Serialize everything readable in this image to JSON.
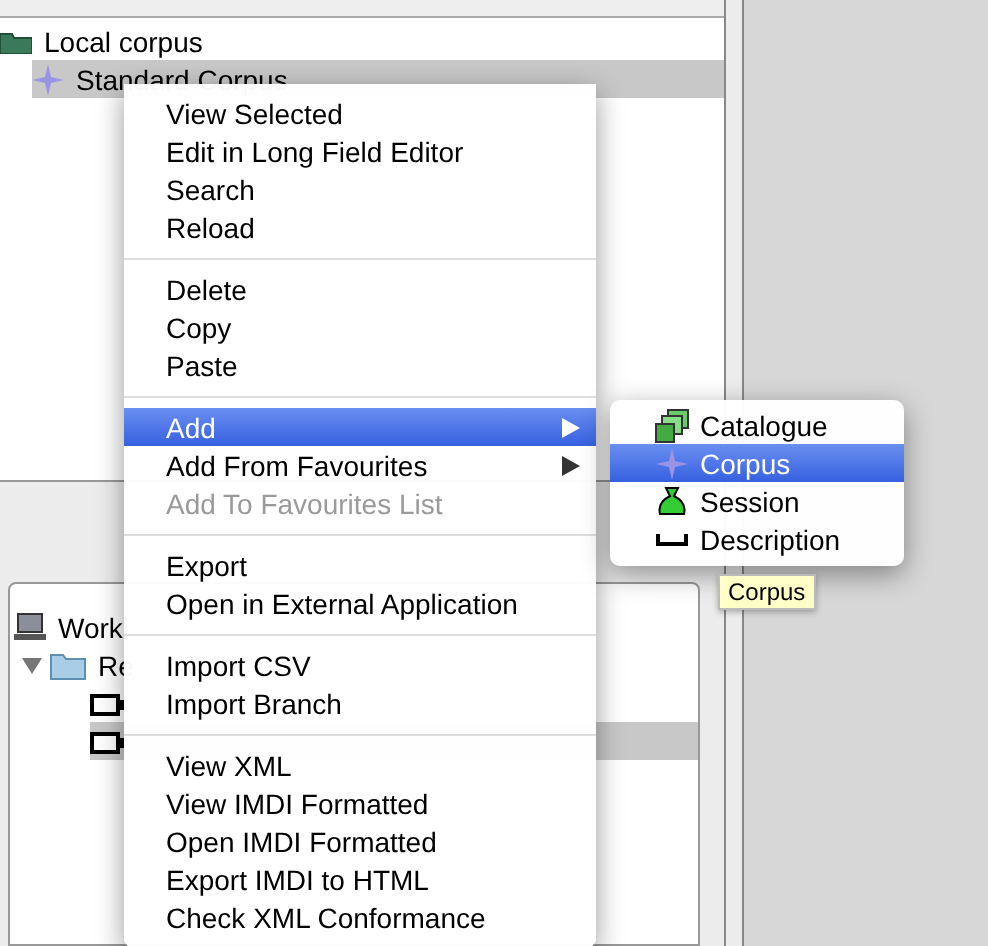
{
  "tree": [
    {
      "label": "Local corpus",
      "kind": "folder",
      "children": [
        {
          "label": "Standard Corpus",
          "kind": "corpus",
          "selected": true
        }
      ]
    }
  ],
  "lower_tree": [
    {
      "label": "Worki",
      "kind": "computer",
      "children": [
        {
          "label": "Re",
          "kind": "folder",
          "expanded": true,
          "children": [
            {
              "kind": "file",
              "selected": false
            },
            {
              "kind": "file",
              "selected": true
            }
          ]
        }
      ]
    }
  ],
  "context_menu": {
    "groups": [
      {
        "items": [
          {
            "label": "View Selected",
            "selected": false,
            "disabled": false,
            "submenu": false
          },
          {
            "label": "Edit in Long Field Editor",
            "selected": false,
            "disabled": false,
            "submenu": false
          },
          {
            "label": "Search",
            "selected": false,
            "disabled": false,
            "submenu": false
          },
          {
            "label": "Reload",
            "selected": false,
            "disabled": false,
            "submenu": false
          }
        ]
      },
      {
        "items": [
          {
            "label": "Delete",
            "selected": false,
            "disabled": false,
            "submenu": false
          },
          {
            "label": "Copy",
            "selected": false,
            "disabled": false,
            "submenu": false
          },
          {
            "label": "Paste",
            "selected": false,
            "disabled": false,
            "submenu": false
          }
        ]
      },
      {
        "items": [
          {
            "label": "Add",
            "selected": true,
            "disabled": false,
            "submenu": true
          },
          {
            "label": "Add From Favourites",
            "selected": false,
            "disabled": false,
            "submenu": true
          },
          {
            "label": "Add To Favourites List",
            "selected": false,
            "disabled": true,
            "submenu": false
          }
        ]
      },
      {
        "items": [
          {
            "label": "Export",
            "selected": false,
            "disabled": false,
            "submenu": false
          },
          {
            "label": "Open in External Application",
            "selected": false,
            "disabled": false,
            "submenu": false
          }
        ]
      },
      {
        "items": [
          {
            "label": "Import CSV",
            "selected": false,
            "disabled": false,
            "submenu": false
          },
          {
            "label": "Import Branch",
            "selected": false,
            "disabled": false,
            "submenu": false
          }
        ]
      },
      {
        "items": [
          {
            "label": "View XML",
            "selected": false,
            "disabled": false,
            "submenu": false
          },
          {
            "label": "View IMDI Formatted",
            "selected": false,
            "disabled": false,
            "submenu": false
          },
          {
            "label": "Open IMDI Formatted",
            "selected": false,
            "disabled": false,
            "submenu": false
          },
          {
            "label": "Export IMDI to HTML",
            "selected": false,
            "disabled": false,
            "submenu": false
          },
          {
            "label": "Check XML Conformance",
            "selected": false,
            "disabled": false,
            "submenu": false
          }
        ]
      }
    ]
  },
  "submenu": {
    "items": [
      {
        "label": "Catalogue",
        "kind": "catalogue",
        "selected": false
      },
      {
        "label": "Corpus",
        "kind": "corpus",
        "selected": true
      },
      {
        "label": "Session",
        "kind": "session",
        "selected": false
      },
      {
        "label": "Description",
        "kind": "description",
        "selected": false
      }
    ]
  },
  "tooltip": {
    "text": "Corpus"
  }
}
